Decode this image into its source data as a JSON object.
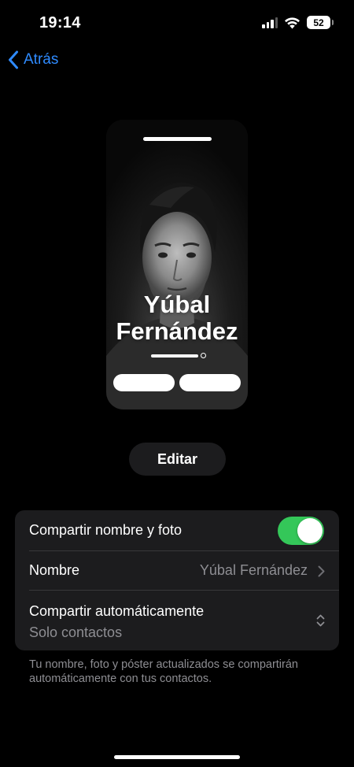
{
  "status_bar": {
    "time": "19:14",
    "battery": "52",
    "icons": [
      "signal-icon",
      "wifi-icon",
      "battery-icon"
    ]
  },
  "nav": {
    "back_label": "Atrás",
    "back_icon": "chevron-left-icon",
    "accent_color": "#2f8bff"
  },
  "poster": {
    "name_first": "Yúbal",
    "name_last": "Fernández"
  },
  "edit_button": {
    "label": "Editar"
  },
  "settings": {
    "share": {
      "label": "Compartir nombre y foto",
      "toggle_on": true,
      "toggle_color": "#34c759"
    },
    "name": {
      "label": "Nombre",
      "value": "Yúbal Fernández"
    },
    "auto_share": {
      "label": "Compartir automáticamente",
      "value": "Solo contactos"
    }
  },
  "footer_note": "Tu nombre, foto y póster actualizados se compartirán automáticamente con tus contactos."
}
